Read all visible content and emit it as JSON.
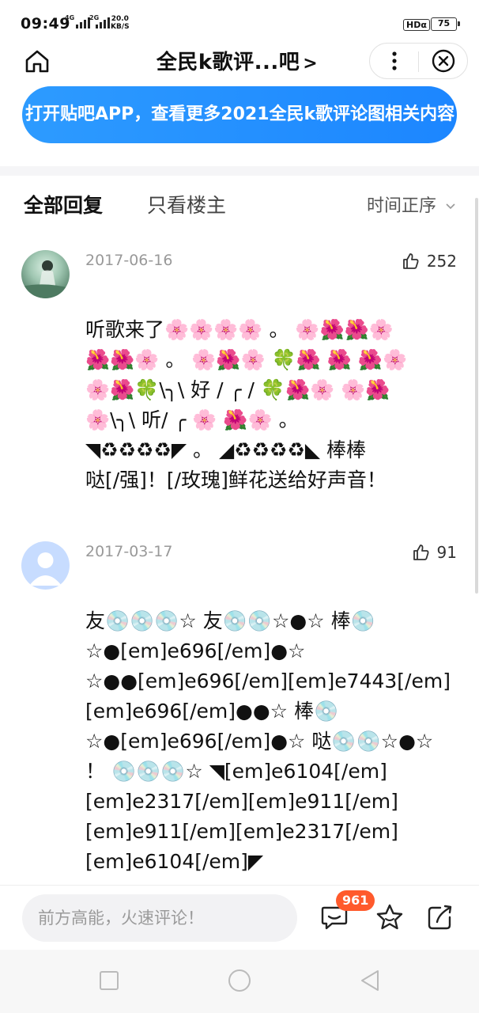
{
  "status_bar": {
    "time": "09:49",
    "net_top": "4G",
    "net_bottom": "2G",
    "speed_value": "20.0",
    "speed_unit": "KB/S",
    "hd_label": "HDα",
    "battery": "75"
  },
  "header": {
    "title": "全民k歌评...吧",
    "title_chevron": ">",
    "home_icon": "home-icon",
    "more_icon": "more-icon",
    "close_icon": "close-icon"
  },
  "banner": {
    "text": "打开贴吧APP，查看更多2021全民k歌评论图相关内容"
  },
  "tabs": {
    "all_replies": "全部回复",
    "only_op": "只看楼主",
    "sort_label": "时间正序"
  },
  "posts": [
    {
      "date": "2017-06-16",
      "likes": "252",
      "lines": [
        "听歌来了🌸🌸🌸🌸 。    🌸🌺🌺🌸",
        "🌺🌺🌸 。 🌸🌺🌸 🍀🌺 🌺 🌺🌸",
        "🌸🌺🍀\\╮\\ 好 / ╭ / 🍀🌺🌸 🌸🌺",
        "🌸\\╮\\ 听/ ╭ 🌸  🌺🌸 。",
        "◥♻♻♻♻◤ 。     ◢♻♻♻♻◣ 棒棒",
        "哒[/强]！[/玫瑰]鲜花送给好声音！"
      ]
    },
    {
      "date": "2017-03-17",
      "likes": "91",
      "lines": [
        "友💿💿💿☆ 友💿💿☆●☆ 棒💿",
        "☆●[em]e696[/em]●☆",
        "☆●●[em]e696[/em][em]e7443[/em]",
        "[em]e696[/em]●●☆ 棒💿",
        "☆●[em]e696[/em]●☆ 哒💿💿☆●☆",
        "！ 💿💿💿☆ ◥[em]e6104[/em]",
        "[em]e2317[/em][em]e911[/em]",
        "[em]e911[/em][em]e2317[/em]",
        "[em]e6104[/em]◤"
      ]
    }
  ],
  "comment_bar": {
    "placeholder": "前方高能，火速评论！",
    "comment_count": "961",
    "comment_icon": "comment-icon",
    "star_icon": "star-icon",
    "share_icon": "share-icon"
  },
  "colors": {
    "banner": "#1c86ff",
    "badge": "#ff5a2c"
  }
}
